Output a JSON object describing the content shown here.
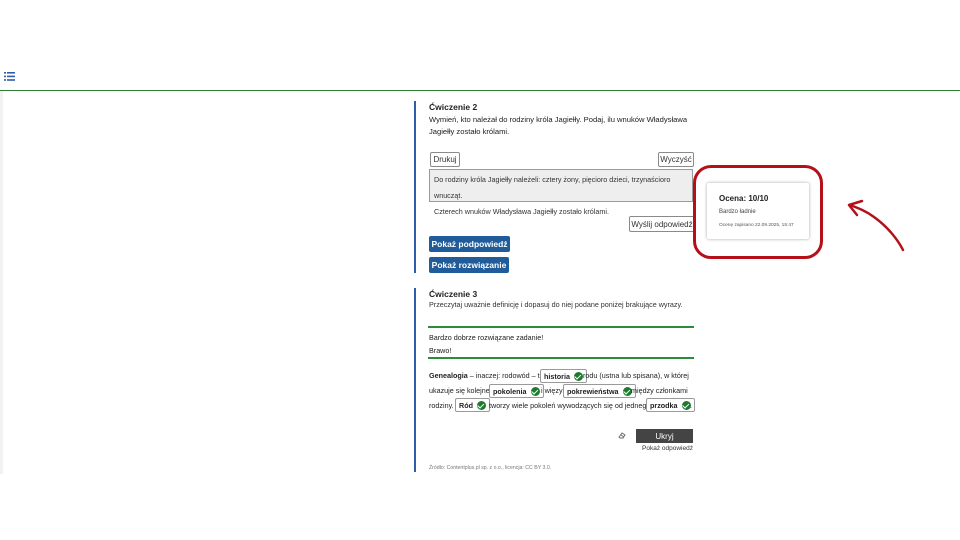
{
  "exercise2": {
    "title": "Ćwiczenie 2",
    "prompt_line1": "Wymień, kto należał do rodziny króla Jagiełły. Podaj, ilu wnuków Władysława",
    "prompt_line2": "Jagiełły zostało królami.",
    "print_button": "Drukuj",
    "clear_button": "Wyczyść",
    "answer_line1": "Do rodziny króla Jagiełły należeli: cztery żony, pięcioro dzieci, trzynaściorо wnucząt.",
    "answer_line2": "Czterech wnuków Władysława Jagiełły zostało królami.",
    "send_button": "Wyślij odpowiedź",
    "hint_button": "Pokaż podpowiedź",
    "solution_button": "Pokaż rozwiązanie"
  },
  "grade_card": {
    "title": "Ocena: 10/10",
    "comment": "Bardzo ładnie",
    "saved": "Ocenę zapisano 22.09.2025, 15:47"
  },
  "exercise3": {
    "title": "Ćwiczenie 3",
    "prompt": "Przeczytaj uważnie definicję i dopasuj do niej podane poniżej brakujące wyrazy.",
    "feedback_title": "Bardzo dobrze rozwiązane zadanie!",
    "feedback_text": "Brawo!",
    "text": {
      "term": "Genealogia",
      "l1_a": " – inaczej: rodowód – to",
      "l1_b": "rodu (ustna lub spisana), w której",
      "l2_a": "ukazuje się kolejne",
      "l2_b": "i więzy",
      "l2_c": "między członkami",
      "l3_a": "rodziny.",
      "l3_b": "tworzy wiele pokoleń wywodzących się od jednego",
      "l3_c": "."
    },
    "chips": [
      "historia",
      "pokolenia",
      "pokrewieństwa",
      "Ród",
      "przodka"
    ],
    "hide_button": "Ukryj",
    "show_answer_link": "Pokaż odpowiedź",
    "source": "Źródło: Contentplus.pl sp. z o.o., licencja: CC BY 3.0."
  },
  "colors": {
    "primary_button": "#1f5c99",
    "accent_line": "#2e8b3a",
    "annotation": "#b3101a"
  },
  "icons": [
    "list-menu-icon",
    "eraser-icon",
    "check-icon",
    "annotation-arrow-icon"
  ]
}
